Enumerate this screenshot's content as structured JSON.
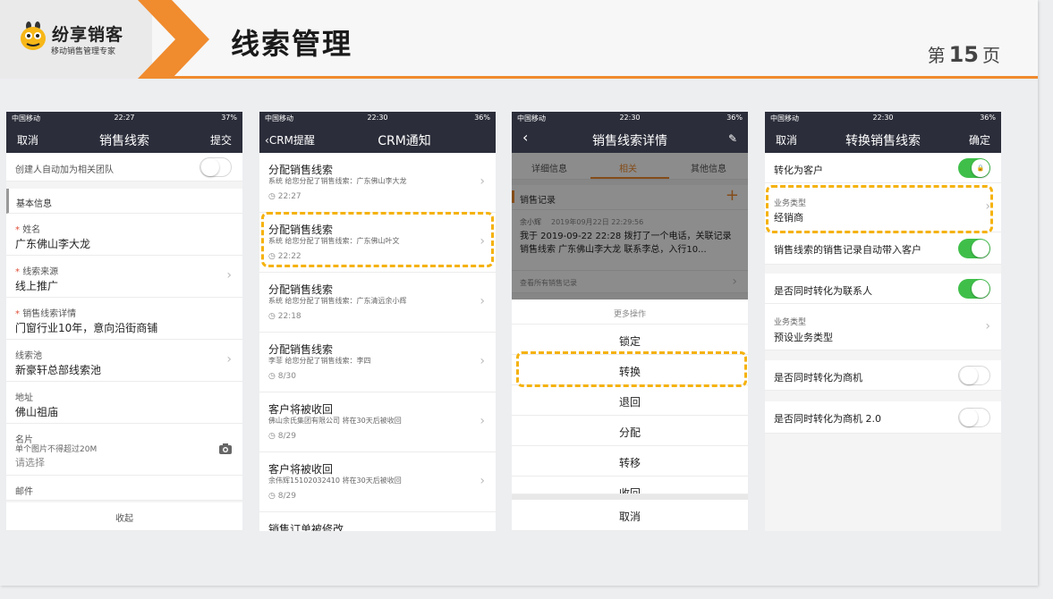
{
  "header": {
    "brand_name": "纷享销客",
    "brand_tagline": "移动销售管理专家",
    "title": "线索管理",
    "page_prefix": "第",
    "page_number": "15",
    "page_suffix": "页",
    "accent_color": "#f08b2e"
  },
  "phone1": {
    "status": {
      "carrier": "中国移动",
      "time": "22:27",
      "battery": "37%"
    },
    "nav": {
      "left": "取消",
      "title": "销售线索",
      "right": "提交"
    },
    "auto_team_label": "创建人自动加为相关团队",
    "section_title": "基本信息",
    "fields": {
      "name_label": "姓名",
      "name_value": "广东佛山李大龙",
      "source_label": "线索来源",
      "source_value": "线上推广",
      "detail_label": "销售线索详情",
      "detail_value": "门窗行业10年，意向沿街商铺",
      "pool_label": "线索池",
      "pool_value": "新豪轩总部线索池",
      "address_label": "地址",
      "address_value": "佛山祖庙",
      "card_label": "名片",
      "card_hint": "单个图片不得超过20M",
      "card_placeholder": "请选择",
      "mail_label": "邮件"
    },
    "collapse": "收起"
  },
  "phone2": {
    "status": {
      "carrier": "中国移动",
      "time": "22:30",
      "battery": "36%"
    },
    "nav": {
      "back": "CRM提醒",
      "title": "CRM通知"
    },
    "items": [
      {
        "title": "分配销售线索",
        "sub": "系统 给您分配了销售线索：广东佛山李大龙",
        "time": "22:27"
      },
      {
        "title": "分配销售线索",
        "sub": "系统 给您分配了销售线索：广东佛山叶文",
        "time": "22:22"
      },
      {
        "title": "分配销售线索",
        "sub": "系统 给您分配了销售线索：广东清远余小辉",
        "time": "22:18"
      },
      {
        "title": "分配销售线索",
        "sub": "李菲 给您分配了销售线索：李四",
        "time": "8/30"
      },
      {
        "title": "客户将被收回",
        "sub": "佛山余氏集团有限公司 将在30天后被收回",
        "time": "8/29"
      },
      {
        "title": "客户将被收回",
        "sub": "余伟辉15102032410 将在30天后被收回",
        "time": "8/29"
      },
      {
        "title": "销售订单被修改",
        "sub": "",
        "time": ""
      }
    ]
  },
  "phone3": {
    "status": {
      "carrier": "中国移动",
      "time": "22:30",
      "battery": "36%"
    },
    "nav": {
      "title": "销售线索详情"
    },
    "tabs": [
      "详细信息",
      "相关",
      "其他信息"
    ],
    "record_title": "销售记录",
    "record_user": "余小辉",
    "record_time": "2019年09月22日 22:29:56",
    "record_text": "我于 2019-09-22 22:28 拨打了一个电话，关联记录 销售线索 广东佛山李大龙 联系李总，入行10...",
    "view_all": "查看所有销售记录",
    "sheet_title": "更多操作",
    "actions": [
      "锁定",
      "转换",
      "退回",
      "分配",
      "转移",
      "收回"
    ],
    "cancel": "取消"
  },
  "phone4": {
    "status": {
      "carrier": "中国移动",
      "time": "22:30",
      "battery": "36%"
    },
    "nav": {
      "left": "取消",
      "title": "转换销售线索",
      "right": "确定"
    },
    "to_customer": "转化为客户",
    "biz_type_label": "业务类型",
    "biz_type_value": "经销商",
    "auto_record": "销售线索的销售记录自动带入客户",
    "to_contact": "是否同时转化为联系人",
    "biz_type_label2": "业务类型",
    "biz_type_value2": "预设业务类型",
    "to_opportunity": "是否同时转化为商机",
    "to_opportunity2": "是否同时转化为商机 2.0",
    "toggles": {
      "customer": true,
      "auto_record": true,
      "contact": true,
      "opportunity": false,
      "opportunity2": false
    }
  }
}
